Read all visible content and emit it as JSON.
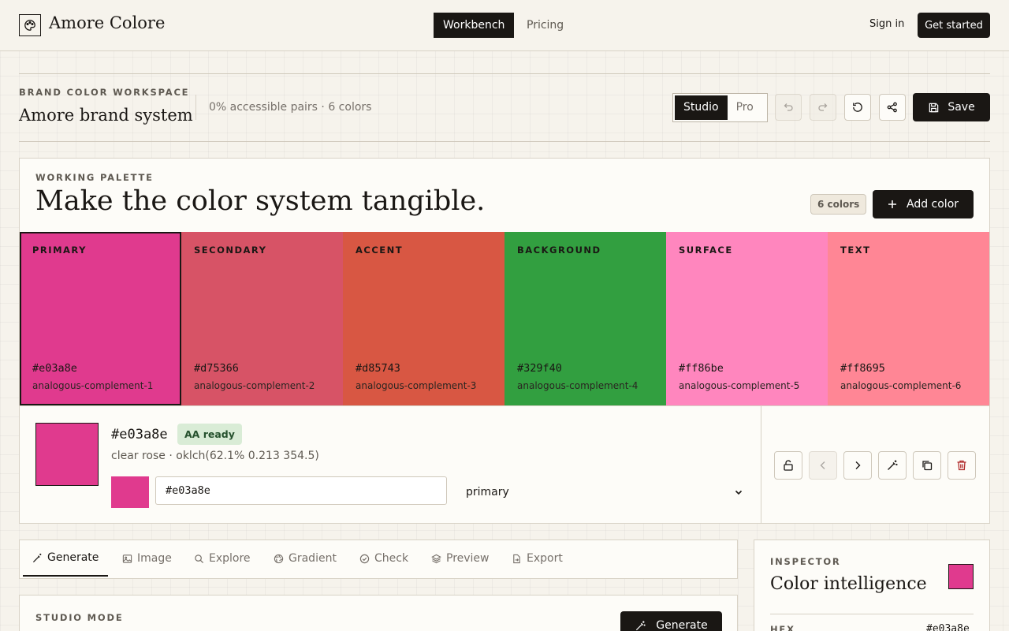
{
  "nav": {
    "brand": "Amore Colore",
    "tabs": [
      {
        "label": "Workbench",
        "active": true
      },
      {
        "label": "Pricing",
        "active": false
      }
    ],
    "signin": "Sign in",
    "cta": "Get started"
  },
  "workspace": {
    "eyebrow": "BRAND COLOR WORKSPACE",
    "title": "Amore brand system",
    "stats": "0% accessible pairs · 6 colors",
    "mode_options": [
      "Studio",
      "Pro"
    ],
    "mode_selected": "Studio",
    "save_label": "Save",
    "icons": [
      "undo-icon",
      "redo-icon",
      "reset-icon",
      "share-icon",
      "save-icon"
    ]
  },
  "palette": {
    "eyebrow": "WORKING PALETTE",
    "title": "Make the color system tangible.",
    "count_badge": "6 colors",
    "add_label": "Add color",
    "swatches": [
      {
        "role": "PRIMARY",
        "hex": "#e03a8e",
        "name": "analogous-complement-1",
        "color": "#e03a8e",
        "selected": true
      },
      {
        "role": "SECONDARY",
        "hex": "#d75366",
        "name": "analogous-complement-2",
        "color": "#d75366"
      },
      {
        "role": "ACCENT",
        "hex": "#d85743",
        "name": "analogous-complement-3",
        "color": "#d85743"
      },
      {
        "role": "BACKGROUND",
        "hex": "#329f40",
        "name": "analogous-complement-4",
        "color": "#329f40"
      },
      {
        "role": "SURFACE",
        "hex": "#ff86be",
        "name": "analogous-complement-5",
        "color": "#ff86be"
      },
      {
        "role": "TEXT",
        "hex": "#ff8695",
        "name": "analogous-complement-6",
        "color": "#ff8695"
      }
    ]
  },
  "detail": {
    "hex": "#e03a8e",
    "badge": "AA ready",
    "description": "clear rose · oklch(62.1% 0.213 354.5)",
    "input_value": "#e03a8e",
    "role_value": "primary",
    "role_options": [
      "primary"
    ],
    "color": "#e03a8e",
    "actions": [
      "unlock-icon",
      "chevron-left-icon",
      "chevron-right-icon",
      "magic-wand-icon",
      "copy-icon",
      "trash-icon"
    ]
  },
  "tabs": [
    {
      "label": "Generate",
      "icon": "wand-icon",
      "active": true
    },
    {
      "label": "Image",
      "icon": "image-icon"
    },
    {
      "label": "Explore",
      "icon": "search-icon"
    },
    {
      "label": "Gradient",
      "icon": "aperture-icon"
    },
    {
      "label": "Check",
      "icon": "check-circle-icon"
    },
    {
      "label": "Preview",
      "icon": "layers-icon"
    },
    {
      "label": "Export",
      "icon": "file-export-icon"
    }
  ],
  "studio": {
    "eyebrow": "STUDIO MODE",
    "generate_label": "Generate"
  },
  "inspector": {
    "eyebrow": "INSPECTOR",
    "title": "Color intelligence",
    "hex_label": "HEX",
    "hex_value": "#e03a8e",
    "color": "#e03a8e"
  }
}
